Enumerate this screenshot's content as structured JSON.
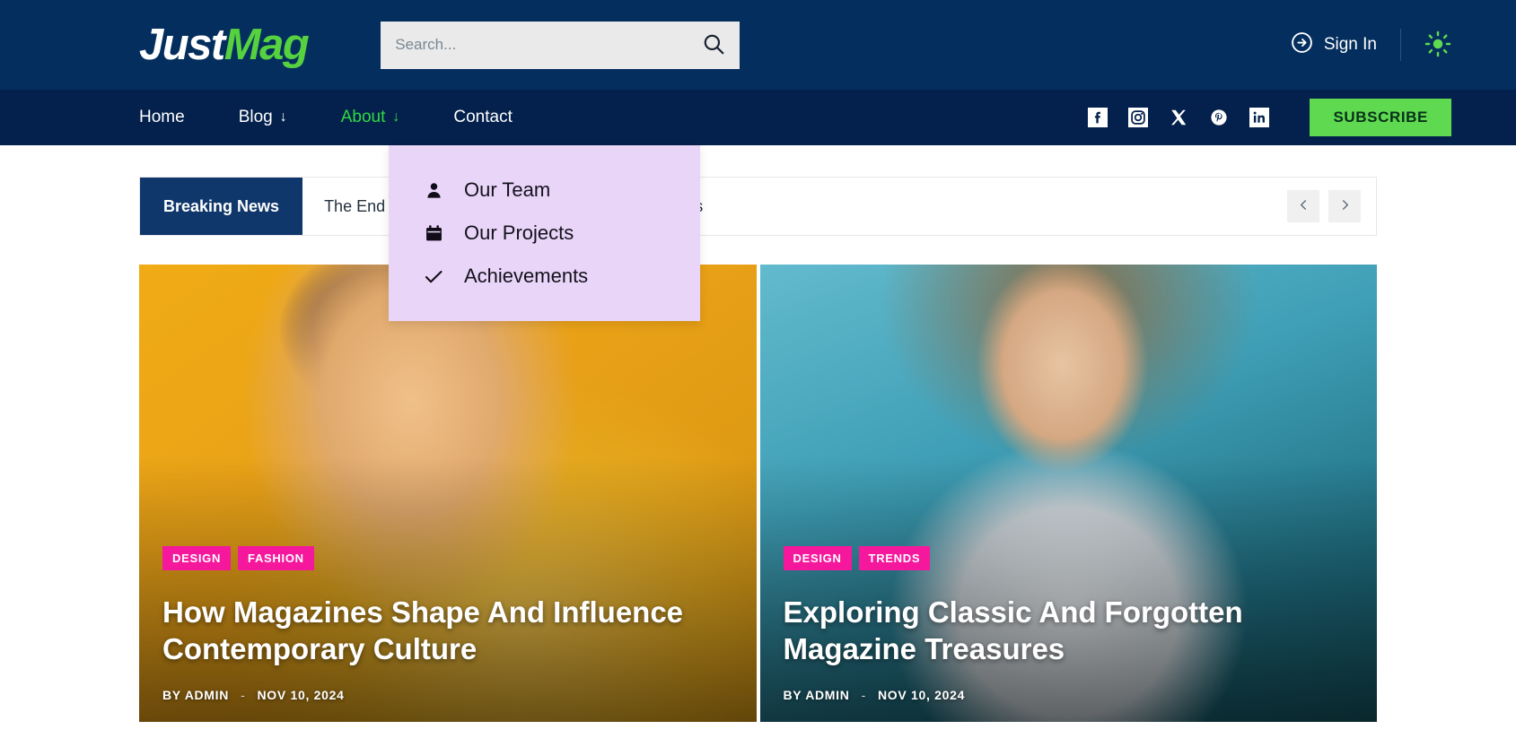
{
  "header": {
    "logo": {
      "part1": "Just",
      "part2": "Mag"
    },
    "search": {
      "placeholder": "Search...",
      "value": "",
      "icon": "search-icon"
    },
    "signin": {
      "label": "Sign In",
      "icon": "arrow-circle-right-icon"
    },
    "theme_toggle": {
      "icon": "sun-icon",
      "color": "#5fd94f"
    }
  },
  "nav": {
    "items": [
      {
        "label": "Home",
        "has_dropdown": false,
        "active": false
      },
      {
        "label": "Blog",
        "has_dropdown": true,
        "active": false,
        "arrow": "↓"
      },
      {
        "label": "About",
        "has_dropdown": true,
        "active": true,
        "arrow": "↓"
      },
      {
        "label": "Contact",
        "has_dropdown": false,
        "active": false
      }
    ],
    "social": [
      {
        "name": "facebook-icon",
        "label": "Facebook"
      },
      {
        "name": "instagram-icon",
        "label": "Instagram"
      },
      {
        "name": "x-twitter-icon",
        "label": "X"
      },
      {
        "name": "pinterest-icon",
        "label": "Pinterest"
      },
      {
        "name": "linkedin-icon",
        "label": "LinkedIn"
      }
    ],
    "subscribe_label": "SUBSCRIBE"
  },
  "dropdown": {
    "open_for": "About",
    "background": "#e9d5f8",
    "items": [
      {
        "label": "Our Team",
        "icon": "person-icon"
      },
      {
        "label": "Our Projects",
        "icon": "calendar-icon"
      },
      {
        "label": "Achievements",
        "icon": "check-icon"
      }
    ]
  },
  "breaking": {
    "label": "Breaking News",
    "headline": "The End Of An Era: Nostalgic Magazine Experiences",
    "prev_icon": "chevron-left-icon",
    "next_icon": "chevron-right-icon"
  },
  "cards": [
    {
      "tags": [
        "DESIGN",
        "FASHION"
      ],
      "title": "How Magazines Shape And Influence Contemporary Culture",
      "author_prefix": "BY",
      "author": "ADMIN",
      "separator": "-",
      "date": "NOV 10, 2024",
      "image_alt": "Man in yellow jacket against yellow background"
    },
    {
      "tags": [
        "DESIGN",
        "TRENDS"
      ],
      "title": "Exploring Classic And Forgotten Magazine Treasures",
      "author_prefix": "BY",
      "author": "ADMIN",
      "separator": "-",
      "date": "NOV 10, 2024",
      "image_alt": "Woman doctor with stethoscope against teal background"
    }
  ],
  "colors": {
    "header_bg": "#042e5e",
    "nav_bg": "#03214c",
    "accent_green": "#5fd94f",
    "active_link": "#31d943",
    "tag_pink": "#f5189c",
    "breaking_badge": "#10376b",
    "dropdown_bg": "#e9d5f8"
  }
}
